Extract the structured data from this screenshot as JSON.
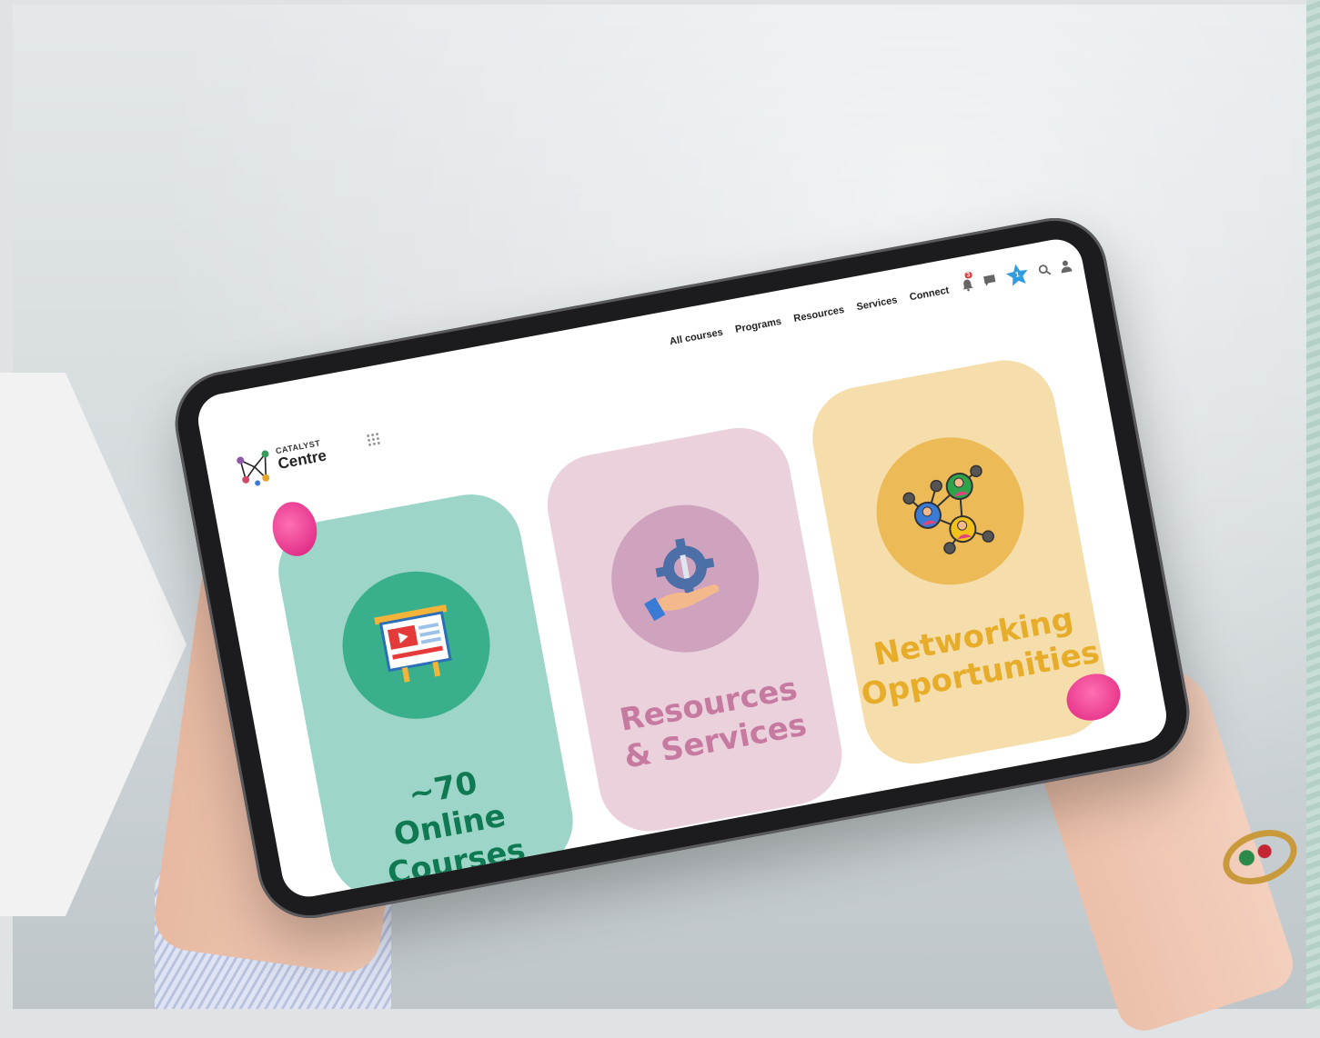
{
  "logo": {
    "sub": "CATALYST",
    "main": "Centre"
  },
  "nav": {
    "items": [
      "All courses",
      "Programs",
      "Resources",
      "Services",
      "Connect"
    ]
  },
  "header_icons": {
    "notification_count": "3",
    "star_count": "1",
    "colors": {
      "badge": "#e23b3b",
      "star": "#2f9be0"
    }
  },
  "cards": [
    {
      "lines": [
        "~70",
        "Online",
        "Courses"
      ],
      "color": "#0f7a52",
      "bg": "#9dd6c8",
      "icon": "presentation-board-icon"
    },
    {
      "lines": [
        "Resources",
        "& Services"
      ],
      "color": "#c77a9f",
      "bg": "#ead1dc",
      "icon": "gear-wrench-hand-icon"
    },
    {
      "lines": [
        "Networking",
        "Opportunities"
      ],
      "color": "#e7ad2a",
      "bg": "#f5deab",
      "icon": "network-people-icon"
    }
  ]
}
